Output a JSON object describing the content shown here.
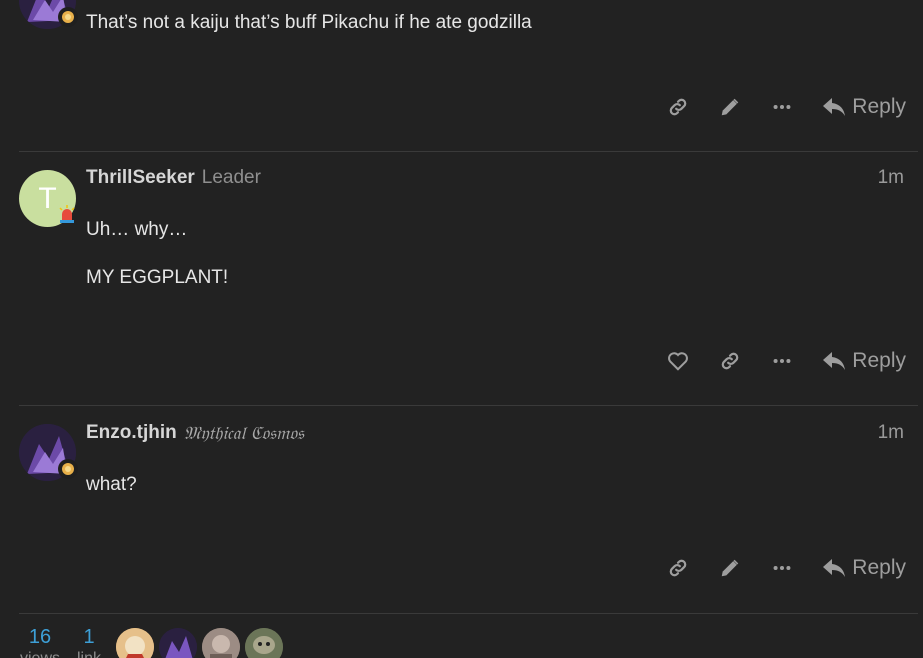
{
  "posts": [
    {
      "body": [
        "That’s not a kaiju that’s buff Pikachu if he ate godzilla"
      ],
      "reply_label": "Reply",
      "actions": [
        "link-icon",
        "edit-icon",
        "more-icon"
      ]
    },
    {
      "username": "ThrillSeeker",
      "user_title": "Leader",
      "time": "1m",
      "avatar_letter": "T",
      "body": [
        "Uh… why…",
        "MY EGGPLANT!"
      ],
      "reply_label": "Reply",
      "actions": [
        "like-icon",
        "link-icon",
        "more-icon"
      ]
    },
    {
      "username": "Enzo.tjhin",
      "user_title": "𝔐𝔶𝔱𝔥𝔦𝔠𝔞𝔩 ℭ𝔬𝔰𝔪𝔬𝔰",
      "time": "1m",
      "body": [
        "what?"
      ],
      "reply_label": "Reply",
      "actions": [
        "link-icon",
        "edit-icon",
        "more-icon"
      ]
    }
  ],
  "footer": {
    "views_count": "16",
    "views_label": "views",
    "links_count": "1",
    "links_label": "link"
  },
  "colors": {
    "background": "#222222",
    "accent_blue": "#3d9fd6",
    "avatar_green": "#c9df9f",
    "icon_gray": "#9e9e9e"
  }
}
